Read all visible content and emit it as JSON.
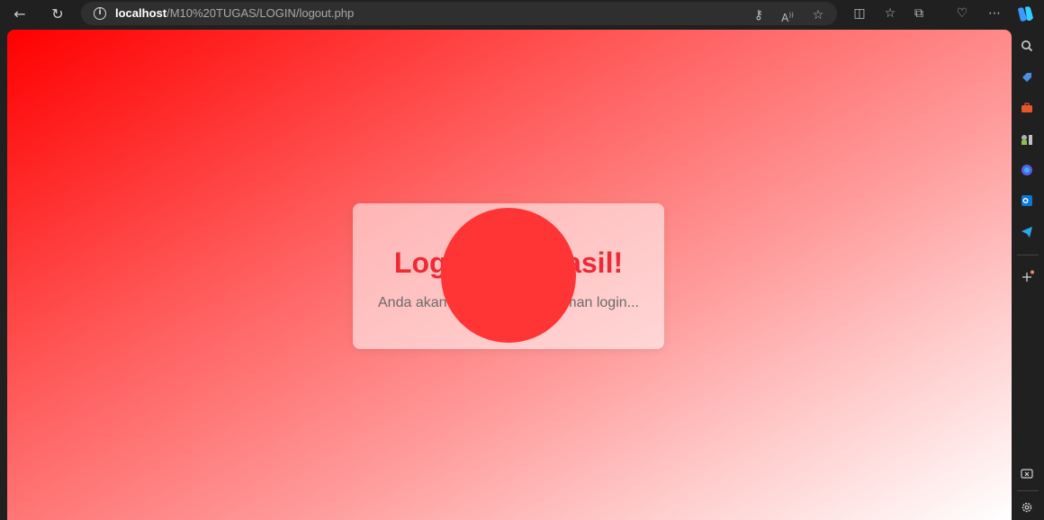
{
  "browser": {
    "url_host": "localhost",
    "url_path": "/M10%20TUGAS/LOGIN/logout.php",
    "icons": [
      "back-icon",
      "refresh-icon",
      "site-info-icon",
      "key-icon",
      "read-aloud-icon",
      "favorite-star-icon",
      "split-screen-icon",
      "favorites-icon",
      "collections-icon",
      "browser-essentials-icon",
      "more-icon",
      "copilot-icon"
    ]
  },
  "sidebar": {
    "icons": [
      "search-icon",
      "shopping-tag-icon",
      "tools-icon",
      "games-icon",
      "microsoft-365-icon",
      "outlook-icon",
      "telegram-icon",
      "add-icon",
      "screenshot-icon",
      "settings-icon"
    ]
  },
  "page": {
    "title": "Logout Berhasil!",
    "message": "Anda akan diarahkan ke halaman login...",
    "colors": {
      "title": "#ee2b34",
      "spinner": "#ff3535",
      "gradient_start": "#ff0000",
      "gradient_end": "#ffffff"
    }
  }
}
